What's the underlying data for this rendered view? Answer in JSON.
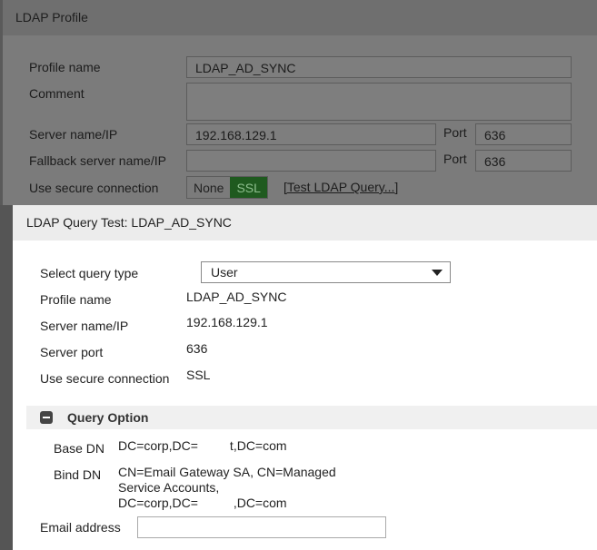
{
  "profile": {
    "title": "LDAP Profile",
    "profile_name_label": "Profile name",
    "profile_name": "LDAP_AD_SYNC",
    "comment_label": "Comment",
    "comment": "",
    "server_label": "Server name/IP",
    "server": "192.168.129.1",
    "port_label": "Port",
    "port": "636",
    "fallback_label": "Fallback server name/IP",
    "fallback": "",
    "fallback_port_label": "Port",
    "fallback_port": "636",
    "secure_label": "Use secure connection",
    "secure_options": [
      "None",
      "SSL"
    ],
    "selected_secure": "SSL",
    "test_link": "[Test LDAP Query...]"
  },
  "dialog": {
    "title": "LDAP Query Test: LDAP_AD_SYNC",
    "query_type_label": "Select query type",
    "query_type": "User",
    "profile_name_label": "Profile name",
    "profile_name": "LDAP_AD_SYNC",
    "server_label": "Server name/IP",
    "server": "192.168.129.1",
    "port_label": "Server port",
    "port": "636",
    "secure_label": "Use secure connection",
    "secure": "SSL",
    "section_title": "Query Option",
    "base_dn_label": "Base DN",
    "base_dn": "DC=corp,DC=         t,DC=com",
    "bind_dn_label": "Bind DN",
    "bind_dn_1": "CN=Email Gateway SA, CN=Managed",
    "bind_dn_2": "Service Accounts,",
    "bind_dn_3": "DC=corp,DC=          ,DC=com",
    "email_label": "Email address",
    "email": ""
  }
}
